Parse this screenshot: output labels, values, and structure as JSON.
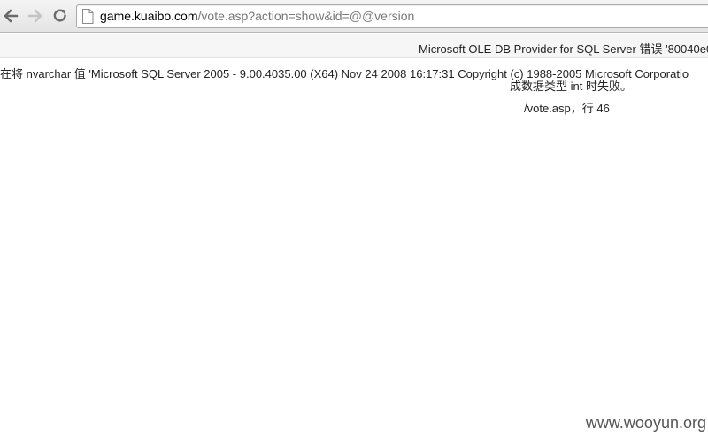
{
  "browser": {
    "url_host": "game.kuaibo.com",
    "url_path": "/vote.asp?action=show&id=@@version",
    "icons": {
      "back": "back-arrow-icon",
      "forward": "forward-arrow-icon",
      "reload": "reload-icon",
      "page": "page-icon"
    }
  },
  "page": {
    "error_title": "Microsoft OLE DB Provider for SQL Server 错误 '80040e0",
    "error_line1": "在将 nvarchar 值 'Microsoft SQL Server 2005 - 9.00.4035.00 (X64) Nov 24 2008 16:17:31 Copyright (c) 1988-2005 Microsoft Corporatio",
    "error_line2": "成数据类型 int 时失败。",
    "error_line3": "/vote.asp，行 46"
  },
  "watermark": "www.wooyun.org"
}
